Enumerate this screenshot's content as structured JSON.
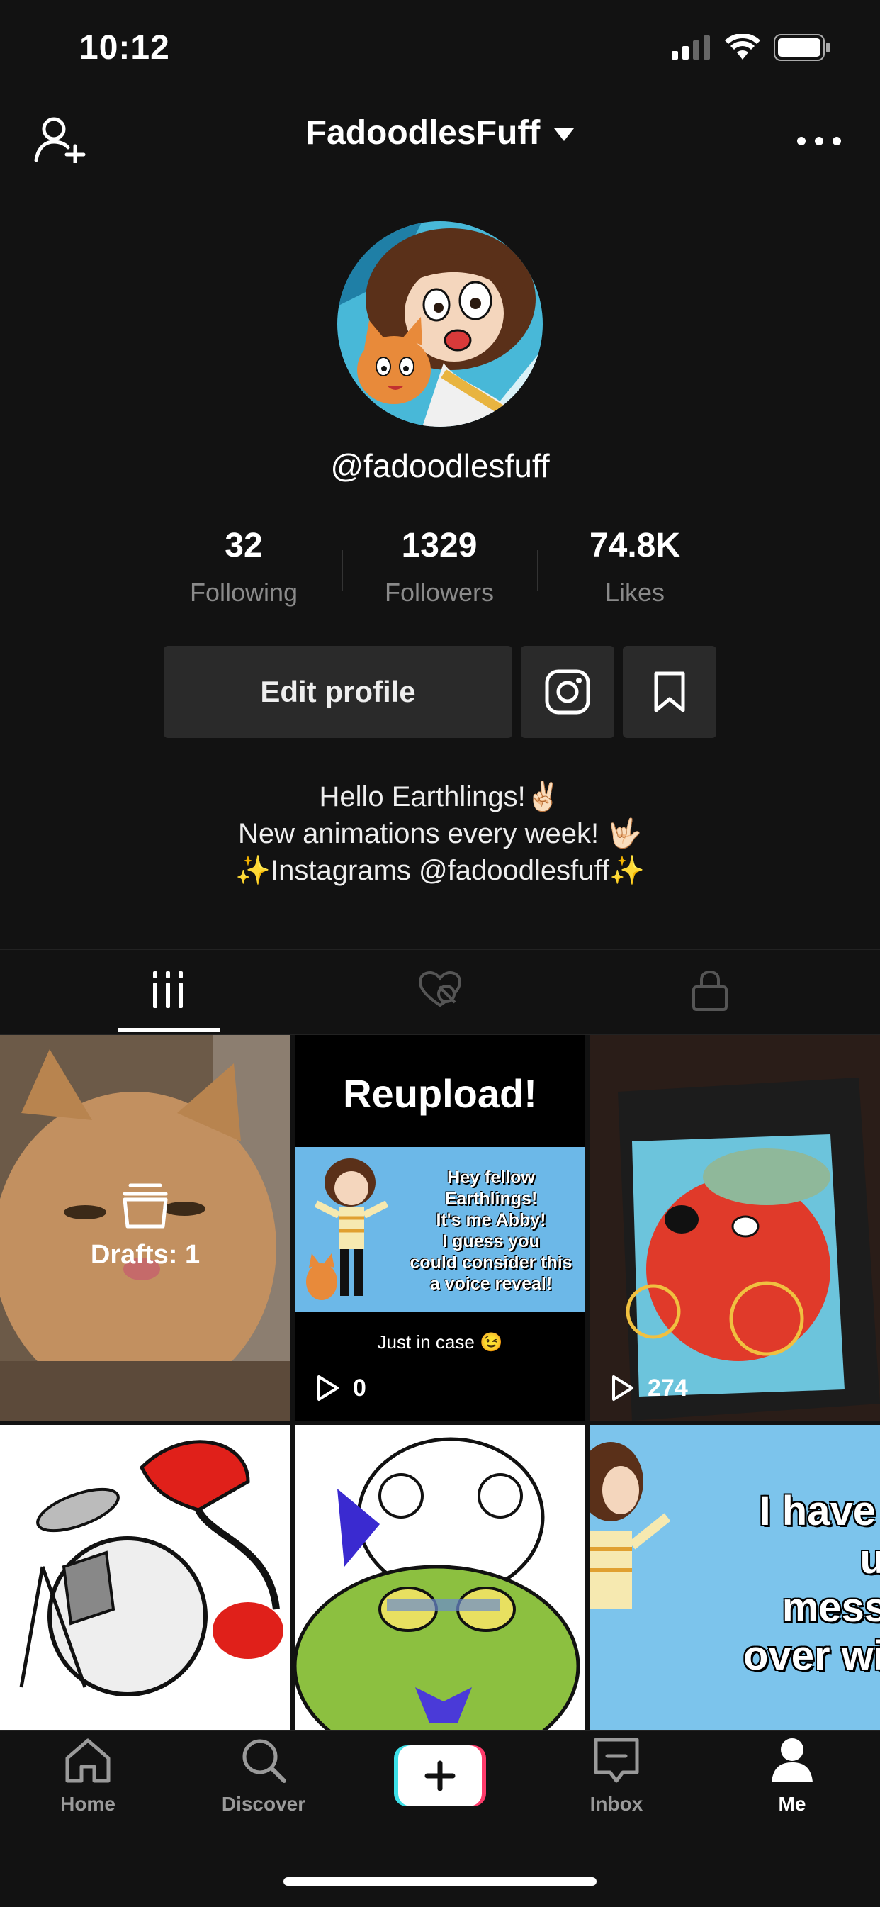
{
  "status": {
    "time": "10:12"
  },
  "header": {
    "username": "FadoodlesFuff"
  },
  "profile": {
    "handle": "@fadoodlesfuff"
  },
  "stats": [
    {
      "value": "32",
      "label": "Following"
    },
    {
      "value": "1329",
      "label": "Followers"
    },
    {
      "value": "74.8K",
      "label": "Likes"
    }
  ],
  "actions": {
    "edit_profile": "Edit profile"
  },
  "bio": [
    "Hello Earthlings!✌🏻",
    "New animations every week! 🤟🏻",
    "✨Instagrams @fadoodlesfuff✨"
  ],
  "tabs": [
    {
      "icon": "grid-bars-icon"
    },
    {
      "icon": "hidden-heart-icon"
    },
    {
      "icon": "lock-icon"
    }
  ],
  "grid": {
    "drafts_label": "Drafts: 1",
    "tile2": {
      "headline": "Reupload!",
      "card_text": [
        "Hey fellow Earthlings!",
        "It's me Abby!",
        "I guess you",
        "could consider this",
        "a voice reveal!"
      ],
      "caption": "Just in case 😉",
      "views": "0"
    },
    "tile3": {
      "views": "274"
    },
    "tile6": {
      "text": [
        "I have an i",
        "upda",
        "message",
        "over with y"
      ]
    }
  },
  "nav": [
    {
      "label": "Home",
      "icon": "home-icon"
    },
    {
      "label": "Discover",
      "icon": "search-icon"
    },
    {
      "label": "",
      "icon": "plus-icon"
    },
    {
      "label": "Inbox",
      "icon": "inbox-icon"
    },
    {
      "label": "Me",
      "icon": "person-icon"
    }
  ],
  "colors": {
    "background": "#121212",
    "button": "#2a2a2a",
    "muted": "#8a8a8a",
    "accent_cyan": "#3de0e8",
    "accent_pink": "#ff3b6b"
  }
}
